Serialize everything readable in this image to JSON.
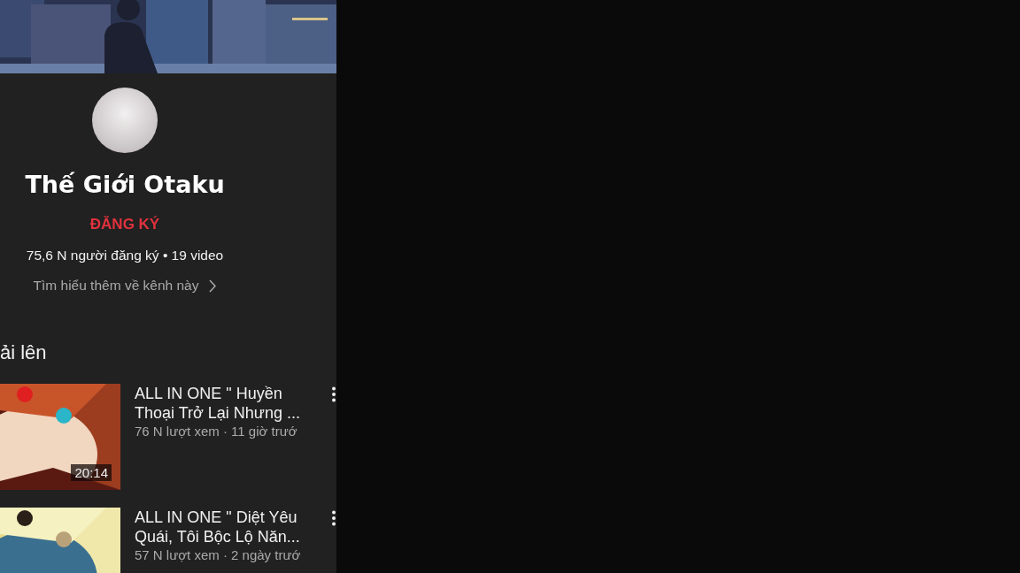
{
  "channel": {
    "name": "Thế Giới Otaku",
    "subscribe": "ĐĂNG KÝ",
    "stats": "75,6 N người đăng ký • 19 video",
    "about": "Tìm hiểu thêm về kênh này"
  },
  "section_title": "ải lên",
  "videos": [
    {
      "title": "ALL IN ONE \" Huyền Thoại Trở Lại Nhưng ...",
      "meta": "76 N lượt xem · 11 giờ trướ",
      "duration": "20:14"
    },
    {
      "title": "ALL IN ONE \" Diệt Yêu Quái, Tôi Bộc Lộ Năn...",
      "meta": "57 N lượt xem · 2 ngày trướ"
    }
  ]
}
